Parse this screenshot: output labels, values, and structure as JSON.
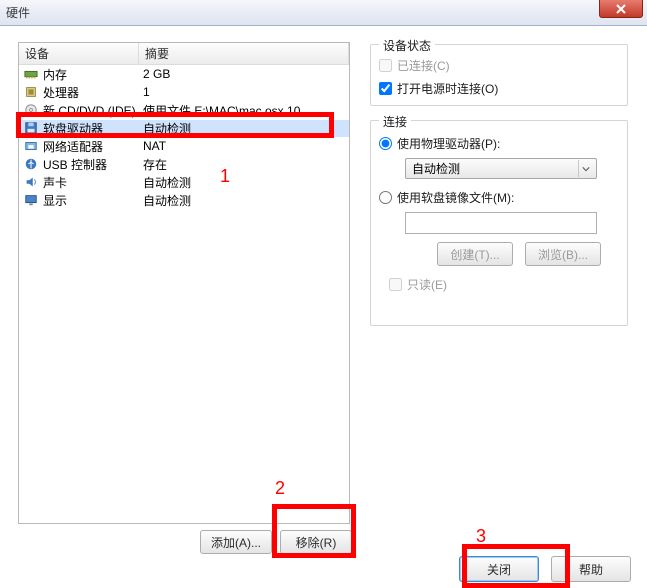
{
  "window": {
    "title": "硬件"
  },
  "left": {
    "headers": {
      "device": "设备",
      "summary": "摘要"
    },
    "rows": [
      {
        "icon": "memory",
        "name": "内存",
        "summary": "2 GB"
      },
      {
        "icon": "cpu",
        "name": "处理器",
        "summary": "1"
      },
      {
        "icon": "cd",
        "name": "新 CD/DVD (IDE)",
        "summary": "使用文件 E:\\MAC\\mac osx 10...."
      },
      {
        "icon": "floppy",
        "name": "软盘驱动器",
        "summary": "自动检测",
        "selected": true
      },
      {
        "icon": "nic",
        "name": "网络适配器",
        "summary": "NAT"
      },
      {
        "icon": "usb",
        "name": "USB 控制器",
        "summary": "存在"
      },
      {
        "icon": "sound",
        "name": "声卡",
        "summary": "自动检测"
      },
      {
        "icon": "display",
        "name": "显示",
        "summary": "自动检测"
      }
    ],
    "buttons": {
      "add": "添加(A)...",
      "remove": "移除(R)"
    }
  },
  "status_group": {
    "title": "设备状态",
    "connected": "已连接(C)",
    "connect_on_power": "打开电源时连接(O)"
  },
  "conn_group": {
    "title": "连接",
    "use_physical": "使用物理驱动器(P):",
    "combo_value": "自动检测",
    "use_image": "使用软盘镜像文件(M):",
    "image_path": "",
    "create_btn": "创建(T)...",
    "browse_btn": "浏览(B)...",
    "readonly": "只读(E)"
  },
  "dialog_buttons": {
    "close": "关闭",
    "help": "帮助"
  },
  "annotations": {
    "n1": "1",
    "n2": "2",
    "n3": "3"
  }
}
